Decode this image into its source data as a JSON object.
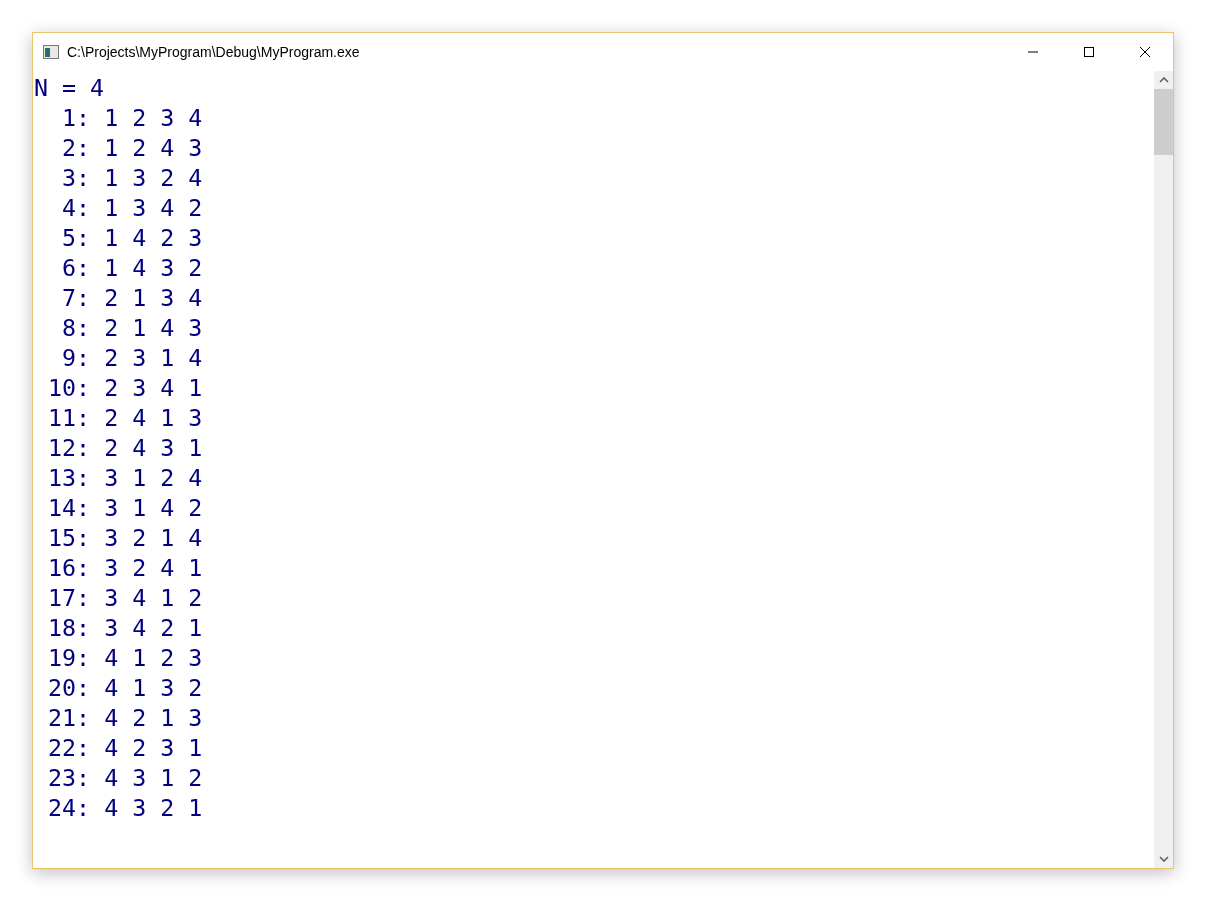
{
  "window": {
    "title": "C:\\Projects\\MyProgram\\Debug\\MyProgram.exe"
  },
  "console": {
    "lines": [
      "N = 4",
      "  1: 1 2 3 4",
      "  2: 1 2 4 3",
      "  3: 1 3 2 4",
      "  4: 1 3 4 2",
      "  5: 1 4 2 3",
      "  6: 1 4 3 2",
      "  7: 2 1 3 4",
      "  8: 2 1 4 3",
      "  9: 2 3 1 4",
      " 10: 2 3 4 1",
      " 11: 2 4 1 3",
      " 12: 2 4 3 1",
      " 13: 3 1 2 4",
      " 14: 3 1 4 2",
      " 15: 3 2 1 4",
      " 16: 3 2 4 1",
      " 17: 3 4 1 2",
      " 18: 3 4 2 1",
      " 19: 4 1 2 3",
      " 20: 4 1 3 2",
      " 21: 4 2 1 3",
      " 22: 4 2 3 1",
      " 23: 4 3 1 2",
      " 24: 4 3 2 1"
    ]
  }
}
